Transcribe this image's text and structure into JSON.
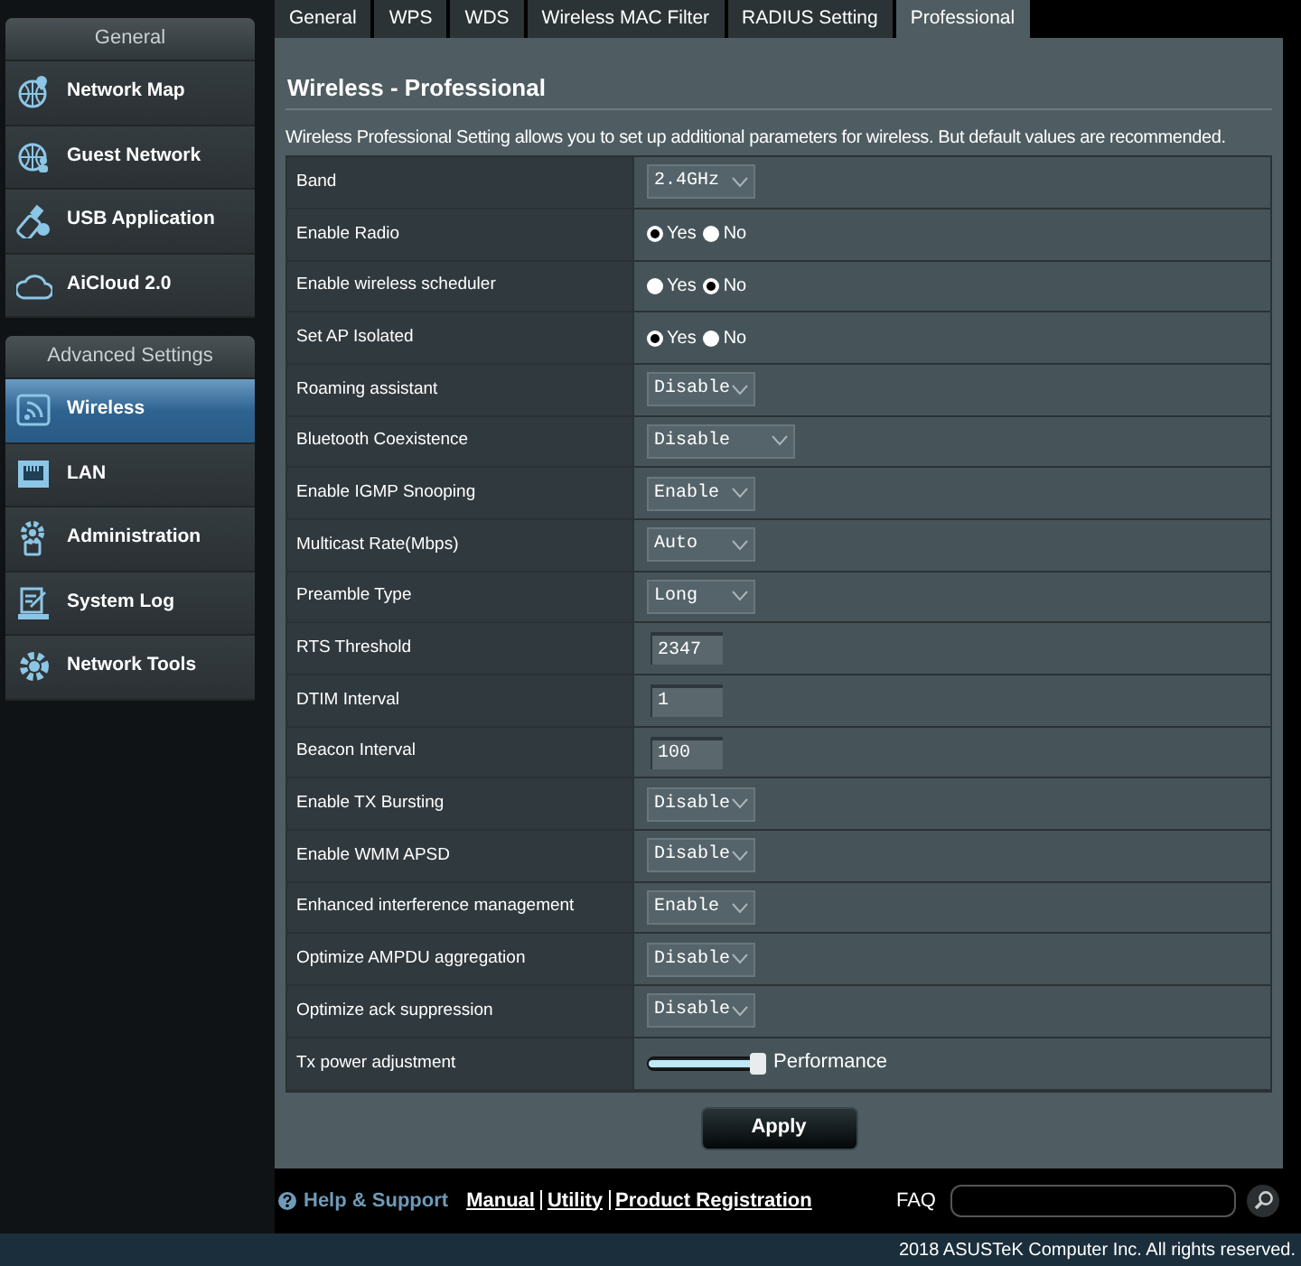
{
  "sidebar": {
    "sections": [
      {
        "title": "General",
        "items": [
          {
            "label": "Network Map",
            "selected": false
          },
          {
            "label": "Guest Network",
            "selected": false
          },
          {
            "label": "USB Application",
            "selected": false
          },
          {
            "label": "AiCloud 2.0",
            "selected": false
          }
        ]
      },
      {
        "title": "Advanced Settings",
        "items": [
          {
            "label": "Wireless",
            "selected": true
          },
          {
            "label": "LAN",
            "selected": false
          },
          {
            "label": "Administration",
            "selected": false
          },
          {
            "label": "System Log",
            "selected": false
          },
          {
            "label": "Network Tools",
            "selected": false
          }
        ]
      }
    ]
  },
  "tabs": [
    {
      "label": "General",
      "selected": false
    },
    {
      "label": "WPS",
      "selected": false
    },
    {
      "label": "WDS",
      "selected": false
    },
    {
      "label": "Wireless MAC Filter",
      "selected": false
    },
    {
      "label": "RADIUS Setting",
      "selected": false
    },
    {
      "label": "Professional",
      "selected": true
    }
  ],
  "title": "Wireless - Professional",
  "description": "Wireless Professional Setting allows you to set up additional parameters for wireless. But default values are recommended.",
  "settings": [
    {
      "label": "Band",
      "kind": "select",
      "value": "2.4GHz"
    },
    {
      "label": "Enable Radio",
      "kind": "radio",
      "options": [
        {
          "label": "Yes",
          "selected": true
        },
        {
          "label": "No",
          "selected": false
        }
      ]
    },
    {
      "label": "Enable wireless scheduler",
      "kind": "radio",
      "options": [
        {
          "label": "Yes",
          "selected": false
        },
        {
          "label": "No",
          "selected": true
        }
      ]
    },
    {
      "label": "Set AP Isolated",
      "kind": "radio",
      "options": [
        {
          "label": "Yes",
          "selected": true
        },
        {
          "label": "No",
          "selected": false
        }
      ]
    },
    {
      "label": "Roaming assistant",
      "kind": "select",
      "value": "Disable"
    },
    {
      "label": "Bluetooth Coexistence",
      "kind": "select",
      "value": "Disable",
      "wide": true
    },
    {
      "label": "Enable IGMP Snooping",
      "kind": "select",
      "value": "Enable"
    },
    {
      "label": "Multicast Rate(Mbps)",
      "kind": "select",
      "value": "Auto"
    },
    {
      "label": "Preamble Type",
      "kind": "select",
      "value": "Long"
    },
    {
      "label": "RTS Threshold",
      "kind": "input",
      "value": "2347"
    },
    {
      "label": "DTIM Interval",
      "kind": "input",
      "value": "1"
    },
    {
      "label": "Beacon Interval",
      "kind": "input",
      "value": "100"
    },
    {
      "label": "Enable TX Bursting",
      "kind": "select",
      "value": "Disable"
    },
    {
      "label": "Enable WMM APSD",
      "kind": "select",
      "value": "Disable"
    },
    {
      "label": "Enhanced interference management",
      "kind": "select",
      "value": "Enable"
    },
    {
      "label": "Optimize AMPDU aggregation",
      "kind": "select",
      "value": "Disable"
    },
    {
      "label": "Optimize ack suppression",
      "kind": "select",
      "value": "Disable"
    },
    {
      "label": "Tx power adjustment",
      "kind": "slider",
      "level": 1,
      "reading": "Performance"
    }
  ],
  "apply_button": "Apply",
  "footer": {
    "help": "Help & Support",
    "links": [
      "Manual",
      "Utility",
      "Product Registration"
    ],
    "faq_label": "FAQ"
  },
  "copyright": "2018 ASUSTeK Computer Inc. All rights reserved."
}
